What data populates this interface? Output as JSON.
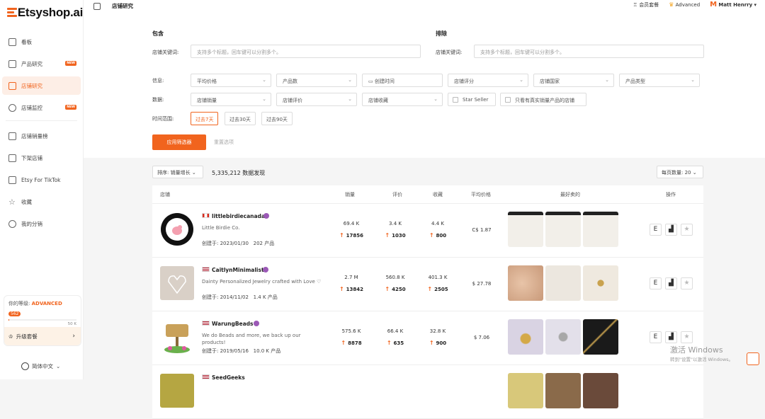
{
  "brand": {
    "name": "Etsyshop.ai",
    "accent": "#f1641e"
  },
  "sidebar": {
    "items": [
      {
        "label": "看板",
        "icon": "home-icon",
        "new": ""
      },
      {
        "label": "产品研究",
        "icon": "product-icon",
        "new": "NEW"
      },
      {
        "label": "店铺研究",
        "icon": "shop-icon",
        "new": "",
        "active": true
      },
      {
        "label": "店铺监控",
        "icon": "monitor-icon",
        "new": "NEW"
      },
      {
        "label": "店铺销量榜",
        "icon": "ranking-icon",
        "new": ""
      },
      {
        "label": "下架店铺",
        "icon": "closed-shop-icon",
        "new": ""
      },
      {
        "label": "Etsy For TikTok",
        "icon": "tiktok-icon",
        "new": ""
      },
      {
        "label": "收藏",
        "icon": "star-icon",
        "new": ""
      },
      {
        "label": "我的分销",
        "icon": "dollar-icon",
        "new": ""
      }
    ],
    "level": {
      "prefix": "你的等级:",
      "value": "ADVANCED",
      "points": "562",
      "max": "50 K",
      "progress": 0.011
    },
    "upgrade": "升级套餐",
    "language": "简体中文"
  },
  "topbar": {
    "title": "店铺研究",
    "membership": "会员套餐",
    "plan": "Advanced",
    "user": "Matt Henrry"
  },
  "filters": {
    "include": "包含",
    "exclude": "排除",
    "keyword_label": "店铺关键词:",
    "keyword_placeholder": "支持多个标题，回车键可以分割多个。",
    "info_label": "信息:",
    "data_label": "数据:",
    "time_label": "时间范围:",
    "info_selects": [
      "平均价格",
      "产品数",
      "创建时间",
      "店铺评分",
      "店铺国家",
      "产品类型"
    ],
    "data_selects": [
      "店铺销量",
      "店铺评价",
      "店铺收藏"
    ],
    "star_seller": "Star Seller",
    "only_real": "只看有真实销量产品的店铺",
    "time_options": [
      "过去7天",
      "过去30天",
      "过去90天"
    ],
    "apply": "应用筛选器",
    "reset": "重置选项"
  },
  "results": {
    "sort": "排序: 销量增长",
    "count": "5,335,212 数据发现",
    "per_page": "每页数量: 20",
    "headers": [
      "店铺",
      "销量",
      "评价",
      "收藏",
      "平均价格",
      "最好卖的",
      "操作"
    ],
    "rows": [
      {
        "name": "littlebirdiecanada",
        "desc": "Little Birdie Co.",
        "created": "创建于: 2023/01/30",
        "products": "202 产品",
        "sales": "69.4 K",
        "sales_growth": "17856",
        "reviews": "3.4 K",
        "reviews_growth": "1030",
        "favs": "4.4 K",
        "favs_growth": "800",
        "price": "C$ 1.87",
        "flag": "CA"
      },
      {
        "name": "CaitlynMinimalist",
        "desc": "Dainty Personalized Jewelry crafted with Love ♡",
        "created": "创建于: 2014/11/02",
        "products": "1.4 K 产品",
        "sales": "2.7 M",
        "sales_growth": "13842",
        "reviews": "560.8 K",
        "reviews_growth": "4250",
        "favs": "401.3 K",
        "favs_growth": "2505",
        "price": "$ 27.78",
        "flag": "US"
      },
      {
        "name": "WarungBeads",
        "desc": "We do Beads and more, we back up our products!",
        "created": "创建于: 2019/05/16",
        "products": "10.0 K 产品",
        "sales": "575.6 K",
        "sales_growth": "8878",
        "reviews": "66.4 K",
        "reviews_growth": "635",
        "favs": "32.8 K",
        "favs_growth": "900",
        "price": "$ 7.06",
        "flag": "US"
      },
      {
        "name": "SeedGeeks",
        "flag": "US"
      }
    ]
  },
  "watermark": {
    "title": "激活 Windows",
    "sub": "转到\"设置\"以激活 Windows。"
  }
}
